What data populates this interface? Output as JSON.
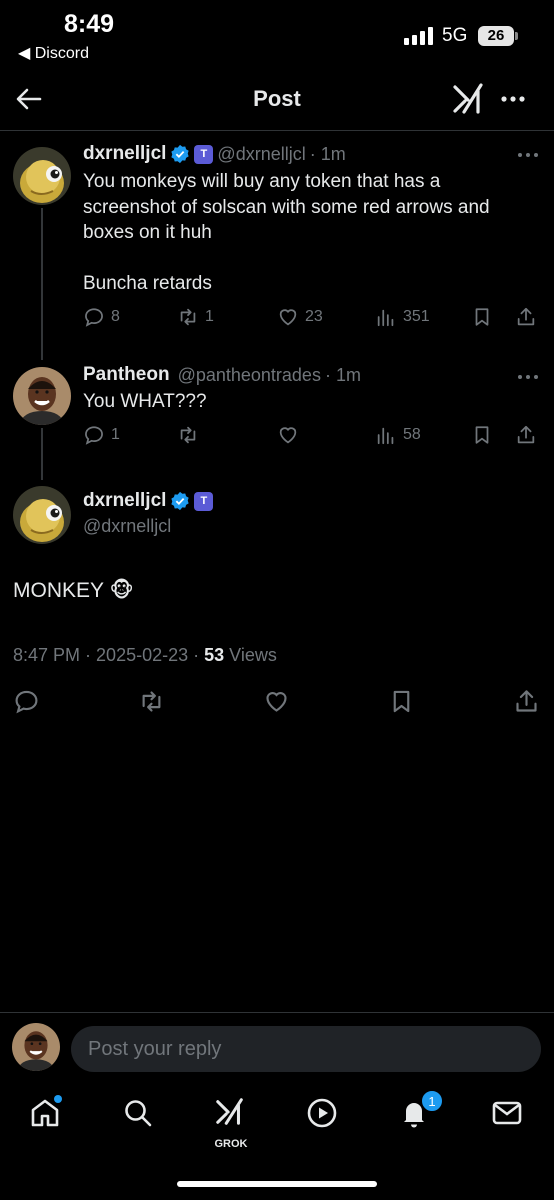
{
  "status_bar": {
    "time": "8:49",
    "back_app": "◀ Discord",
    "network": "5G",
    "battery": "26"
  },
  "header": {
    "title": "Post"
  },
  "thread": [
    {
      "display_name": "dxrnelljcl",
      "handle": "@dxrnelljcl",
      "time": "· 1m",
      "text": "You monkeys will buy any token that has a screenshot of solscan with some red arrows and boxes on it huh\n\nBuncha retards",
      "replies": "8",
      "reposts": "1",
      "likes": "23",
      "views": "351"
    },
    {
      "display_name": "Pantheon",
      "handle": "@pantheontrades",
      "time": "· 1m",
      "text": "You WHAT???",
      "replies": "1",
      "reposts": "",
      "likes": "",
      "views": "58"
    }
  ],
  "main_post": {
    "display_name": "dxrnelljcl",
    "handle": "@dxrnelljcl",
    "text": "MONKEY 🐵",
    "time": "8:47 PM",
    "date": "2025-02-23",
    "views_count": "53",
    "views_label": "Views"
  },
  "reply": {
    "placeholder": "Post your reply"
  },
  "bottom_nav": {
    "grok_label": "GROK",
    "notifications_count": "1"
  },
  "colors": {
    "background": "#000000",
    "accent": "#1d9bf0",
    "muted": "#71767b",
    "text": "#e7e9ea",
    "verified": "#1d9bf0"
  }
}
